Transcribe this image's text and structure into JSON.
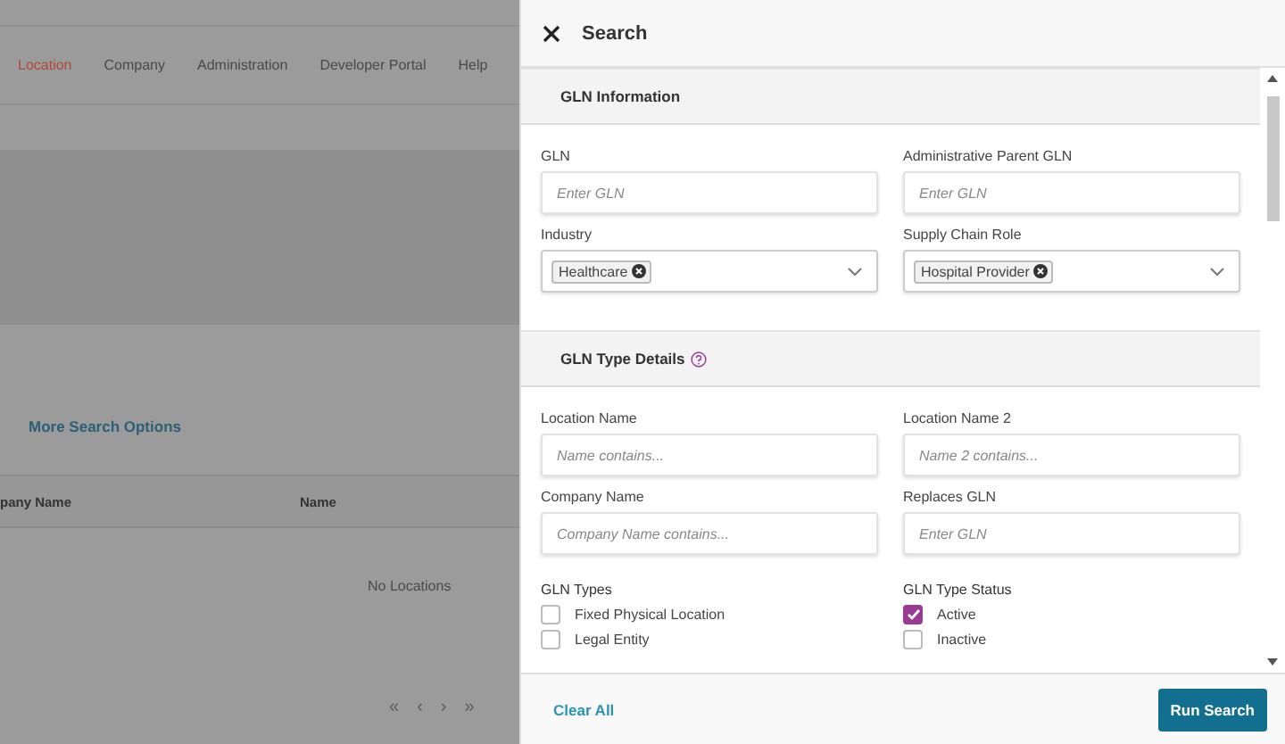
{
  "nav": [
    {
      "label": "Location",
      "selected": true
    },
    {
      "label": "Company",
      "selected": false
    },
    {
      "label": "Administration",
      "selected": false
    },
    {
      "label": "Developer Portal",
      "selected": false
    },
    {
      "label": "Help",
      "selected": false
    }
  ],
  "more_search_options": "More Search Options",
  "table": {
    "columns": [
      "pany Name",
      "Name"
    ],
    "empty_message": "No Locations"
  },
  "pagination": [
    "«",
    "‹",
    "›",
    "»"
  ],
  "panel": {
    "title": "Search",
    "sections": [
      {
        "title": "GLN Information",
        "help": false,
        "fields": [
          {
            "kind": "text",
            "label": "GLN",
            "placeholder": "Enter GLN"
          },
          {
            "kind": "text",
            "label": "Administrative Parent GLN",
            "placeholder": "Enter GLN"
          },
          {
            "kind": "select",
            "label": "Industry",
            "tags": [
              "Healthcare"
            ]
          },
          {
            "kind": "select",
            "label": "Supply Chain Role",
            "tags": [
              "Hospital Provider"
            ]
          }
        ]
      },
      {
        "title": "GLN Type Details",
        "help": true,
        "fields": [
          {
            "kind": "text",
            "label": "Location Name",
            "placeholder": "Name contains..."
          },
          {
            "kind": "text",
            "label": "Location Name 2",
            "placeholder": "Name 2 contains..."
          },
          {
            "kind": "text",
            "label": "Company Name",
            "placeholder": "Company Name contains..."
          },
          {
            "kind": "text",
            "label": "Replaces GLN",
            "placeholder": "Enter GLN"
          },
          {
            "kind": "checks",
            "label": "GLN Types",
            "options": [
              {
                "label": "Fixed Physical Location",
                "checked": false
              },
              {
                "label": "Legal Entity",
                "checked": false
              }
            ]
          },
          {
            "kind": "checks",
            "label": "GLN Type Status",
            "options": [
              {
                "label": "Active",
                "checked": true
              },
              {
                "label": "Inactive",
                "checked": false
              }
            ]
          }
        ]
      }
    ],
    "clear_label": "Clear All",
    "run_label": "Run Search"
  }
}
